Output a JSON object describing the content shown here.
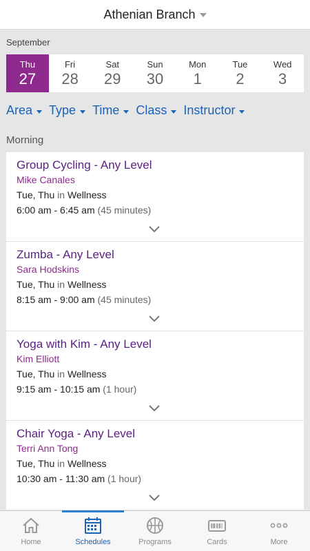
{
  "header": {
    "branch": "Athenian Branch"
  },
  "calendar": {
    "month": "September",
    "days": [
      {
        "name": "Thu",
        "num": "27",
        "active": true
      },
      {
        "name": "Fri",
        "num": "28"
      },
      {
        "name": "Sat",
        "num": "29"
      },
      {
        "name": "Sun",
        "num": "30"
      },
      {
        "name": "Mon",
        "num": "1"
      },
      {
        "name": "Tue",
        "num": "2"
      },
      {
        "name": "Wed",
        "num": "3"
      }
    ]
  },
  "filters": [
    "Area",
    "Type",
    "Time",
    "Class",
    "Instructor"
  ],
  "section": {
    "title": "Morning"
  },
  "classes": [
    {
      "title": "Group Cycling - Any Level",
      "instructor": "Mike Canales",
      "days": "Tue, Thu",
      "in": "in",
      "location": "Wellness",
      "time": "6:00 am - 6:45 am",
      "duration": "(45 minutes)"
    },
    {
      "title": "Zumba - Any Level",
      "instructor": "Sara Hodskins",
      "days": "Tue, Thu",
      "in": "in",
      "location": "Wellness",
      "time": "8:15 am - 9:00 am",
      "duration": "(45 minutes)"
    },
    {
      "title": "Yoga with Kim - Any Level",
      "instructor": "Kim Elliott",
      "days": "Tue, Thu",
      "in": "in",
      "location": "Wellness",
      "time": "9:15 am - 10:15 am",
      "duration": "(1 hour)"
    },
    {
      "title": "Chair Yoga - Any Level",
      "instructor": "Terri Ann Tong",
      "days": "Tue, Thu",
      "in": "in",
      "location": "Wellness",
      "time": "10:30 am - 11:30 am",
      "duration": "(1 hour)"
    }
  ],
  "tabs": [
    {
      "label": "Home",
      "icon": "home-icon"
    },
    {
      "label": "Schedules",
      "icon": "calendar-icon",
      "active": true
    },
    {
      "label": "Programs",
      "icon": "basketball-icon"
    },
    {
      "label": "Cards",
      "icon": "card-icon"
    },
    {
      "label": "More",
      "icon": "more-icon"
    }
  ],
  "colors": {
    "accent_purple": "#8e2a8d",
    "link_blue": "#1a63b8",
    "title_purple": "#5a1f82"
  }
}
